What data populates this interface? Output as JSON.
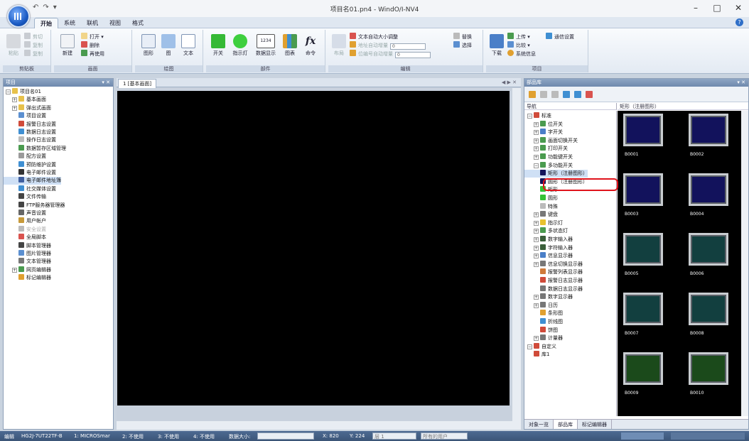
{
  "window": {
    "title": "项目名01.pn4 - WindO/I-NV4",
    "min_label": "–",
    "max_label": "□",
    "close_label": "✕"
  },
  "qat": {
    "undo": "↶",
    "redo": "↷",
    "more": "▾"
  },
  "ribbon_tabs": [
    "开始",
    "系统",
    "联机",
    "视图",
    "格式"
  ],
  "ribbon": {
    "clipboard": {
      "label": "剪贴板",
      "paste": "粘贴",
      "cut": "剪切",
      "copy": "复制",
      "dup": "复制"
    },
    "screen": {
      "label": "画面",
      "new": "新建",
      "open": "打开 ▾",
      "delete": "删除",
      "reuse": "再使用"
    },
    "drawing": {
      "label": "绘图",
      "shape": "图形",
      "image": "图",
      "text": "文本"
    },
    "parts": {
      "label": "部件",
      "switch": "开关",
      "lamp": "指示灯",
      "numeric": "数据显示",
      "chart": "图表",
      "command": "命令",
      "num_icon": "1234"
    },
    "edit": {
      "label": "编辑",
      "arrange": "布局",
      "autosize": "文本自动大小调整",
      "addr_inc": "地址自动增量",
      "addr_val": "0",
      "no_inc": "位编号自动增量",
      "no_val": "0",
      "replace": "替换",
      "select": "选择"
    },
    "project": {
      "label": "项目",
      "download": "下载",
      "upload": "上传 ▾",
      "compare": "比较 ▾",
      "comm": "通信设置",
      "sysinfo": "系统信息"
    }
  },
  "left_panel": {
    "title": "项目",
    "items": [
      {
        "label": "项目名01",
        "exp": "−",
        "indent": 0,
        "icon": "#e7c14b"
      },
      {
        "label": "基本画面",
        "exp": "+",
        "indent": 1,
        "icon": "#e7c14b"
      },
      {
        "label": "弹出式画面",
        "exp": "+",
        "indent": 1,
        "icon": "#e7c14b"
      },
      {
        "label": "项目设置",
        "exp": "",
        "indent": 2,
        "icon": "#5b8fd0"
      },
      {
        "label": "报警日志设置",
        "exp": "",
        "indent": 2,
        "icon": "#d04b3a"
      },
      {
        "label": "数据日志设置",
        "exp": "",
        "indent": 2,
        "icon": "#3f8fd2"
      },
      {
        "label": "操作日志设置",
        "exp": "",
        "indent": 2,
        "icon": "#bbbbbb"
      },
      {
        "label": "数据暂存区域管理",
        "exp": "",
        "indent": 2,
        "icon": "#4a9b4f"
      },
      {
        "label": "配方设置",
        "exp": "",
        "indent": 2,
        "icon": "#9a9a9a"
      },
      {
        "label": "预防维护设置",
        "exp": "",
        "indent": 2,
        "icon": "#3f8fd2"
      },
      {
        "label": "电子邮件设置",
        "exp": "",
        "indent": 2,
        "icon": "#333333"
      },
      {
        "label": "电子邮件地址簿",
        "exp": "",
        "indent": 2,
        "icon": "#3f5f9f",
        "selected": true
      },
      {
        "label": "社交媒体设置",
        "exp": "",
        "indent": 2,
        "icon": "#3f8fd2"
      },
      {
        "label": "文件传输",
        "exp": "",
        "indent": 2,
        "icon": "#444444"
      },
      {
        "label": "FTP服务器管理器",
        "exp": "",
        "indent": 2,
        "icon": "#444444"
      },
      {
        "label": "声音设置",
        "exp": "",
        "indent": 2,
        "icon": "#666666"
      },
      {
        "label": "用户帐户",
        "exp": "",
        "indent": 2,
        "icon": "#c79a3a"
      },
      {
        "label": "安全设置",
        "exp": "",
        "indent": 2,
        "icon": "#bbbbbb",
        "disabled": true
      },
      {
        "label": "全局脚本",
        "exp": "",
        "indent": 2,
        "icon": "#d9534f"
      },
      {
        "label": "脚本管理器",
        "exp": "",
        "indent": 2,
        "icon": "#444444"
      },
      {
        "label": "图片管理器",
        "exp": "",
        "indent": 2,
        "icon": "#5b8fd0"
      },
      {
        "label": "文本管理器",
        "exp": "",
        "indent": 2,
        "icon": "#777777"
      },
      {
        "label": "网页编辑器",
        "exp": "+",
        "indent": 1,
        "icon": "#4a9b4f"
      },
      {
        "label": "标记编辑器",
        "exp": "",
        "indent": 2,
        "icon": "#e0a030"
      }
    ]
  },
  "document": {
    "tab_label": "1  [基本画面]",
    "arrows": "◀ ▶ ✕"
  },
  "right_panel": {
    "title": "部品库",
    "nav_head": "导航",
    "thumb_head": "矩形（注册图形）",
    "items": [
      {
        "label": "标准",
        "indent": 0,
        "exp": "−",
        "icon": "#d04b3a"
      },
      {
        "label": "位开关",
        "indent": 1,
        "exp": "+",
        "icon": "#4a9b4f"
      },
      {
        "label": "字开关",
        "indent": 1,
        "exp": "+",
        "icon": "#4a7fc8"
      },
      {
        "label": "画面切换开关",
        "indent": 1,
        "exp": "+",
        "icon": "#4a9b4f"
      },
      {
        "label": "打印开关",
        "indent": 1,
        "exp": "+",
        "icon": "#4a9b4f"
      },
      {
        "label": "功能键开关",
        "indent": 1,
        "exp": "+",
        "icon": "#4a9b4f"
      },
      {
        "label": "多功能开关",
        "indent": 1,
        "exp": "−",
        "icon": "#4a9b4f"
      },
      {
        "label": "矩形（注册图形）",
        "indent": 2,
        "exp": "",
        "icon": "#14145a",
        "selected": true
      },
      {
        "label": "圆形（注册图形）",
        "indent": 2,
        "exp": "",
        "icon": "#14145a"
      },
      {
        "label": "矩形",
        "indent": 2,
        "exp": "",
        "icon": "#35c235"
      },
      {
        "label": "圆形",
        "indent": 2,
        "exp": "",
        "icon": "#35c235"
      },
      {
        "label": "特殊",
        "indent": 2,
        "exp": "",
        "icon": "#bbbbbb"
      },
      {
        "label": "键盘",
        "indent": 1,
        "exp": "+",
        "icon": "#777777"
      },
      {
        "label": "指示灯",
        "indent": 1,
        "exp": "+",
        "icon": "#e8c22f"
      },
      {
        "label": "多状态灯",
        "indent": 1,
        "exp": "+",
        "icon": "#4a9b4f"
      },
      {
        "label": "数字输入器",
        "indent": 1,
        "exp": "+",
        "icon": "#3a5f3a"
      },
      {
        "label": "字符输入器",
        "indent": 1,
        "exp": "+",
        "icon": "#3a5f3a"
      },
      {
        "label": "信息显示器",
        "indent": 1,
        "exp": "+",
        "icon": "#4a7fc8"
      },
      {
        "label": "信息切换显示器",
        "indent": 1,
        "exp": "+",
        "icon": "#777777"
      },
      {
        "label": "报警列表显示器",
        "indent": 2,
        "exp": "",
        "icon": "#d07a3a"
      },
      {
        "label": "报警日志显示器",
        "indent": 2,
        "exp": "",
        "icon": "#d04b3a"
      },
      {
        "label": "数据日志显示器",
        "indent": 2,
        "exp": "",
        "icon": "#777777"
      },
      {
        "label": "数字显示器",
        "indent": 1,
        "exp": "+",
        "icon": "#777777"
      },
      {
        "label": "日历",
        "indent": 1,
        "exp": "+",
        "icon": "#777777"
      },
      {
        "label": "条形图",
        "indent": 2,
        "exp": "",
        "icon": "#e0a030"
      },
      {
        "label": "折线图",
        "indent": 2,
        "exp": "",
        "icon": "#3f8fd2"
      },
      {
        "label": "饼图",
        "indent": 2,
        "exp": "",
        "icon": "#d04b3a"
      },
      {
        "label": "计量器",
        "indent": 1,
        "exp": "+",
        "icon": "#777777"
      },
      {
        "label": "自定义",
        "indent": 0,
        "exp": "−",
        "icon": "#d04b3a"
      },
      {
        "label": "库1",
        "indent": 1,
        "exp": "",
        "icon": "#d04b3a"
      }
    ],
    "thumbs": [
      {
        "caption": "B0001",
        "color": "#12125c"
      },
      {
        "caption": "B0002",
        "color": "#12125c"
      },
      {
        "caption": "B0003",
        "color": "#12125c"
      },
      {
        "caption": "B0004",
        "color": "#12125c"
      },
      {
        "caption": "B0005",
        "color": "#123f3f"
      },
      {
        "caption": "B0006",
        "color": "#123f3f"
      },
      {
        "caption": "B0007",
        "color": "#123f3f"
      },
      {
        "caption": "B0008",
        "color": "#123f3f"
      },
      {
        "caption": "B0009",
        "color": "#1b4a1b"
      },
      {
        "caption": "B0010",
        "color": "#1b4a1b"
      }
    ],
    "bottom_tabs": [
      "对象一览",
      "部品库",
      "标记编辑器"
    ]
  },
  "status": {
    "mode": "编辑",
    "model": "HG2J-7UT22TF-B",
    "plc1": "1: MICROSmar",
    "plc2": "2: 不使用",
    "plc3": "3: 不使用",
    "plc4": "4: 不使用",
    "datasize": "数据大小:",
    "x": "X: 820",
    "y": "Y: 224",
    "layer": "层 1",
    "user": "所有的用户"
  }
}
